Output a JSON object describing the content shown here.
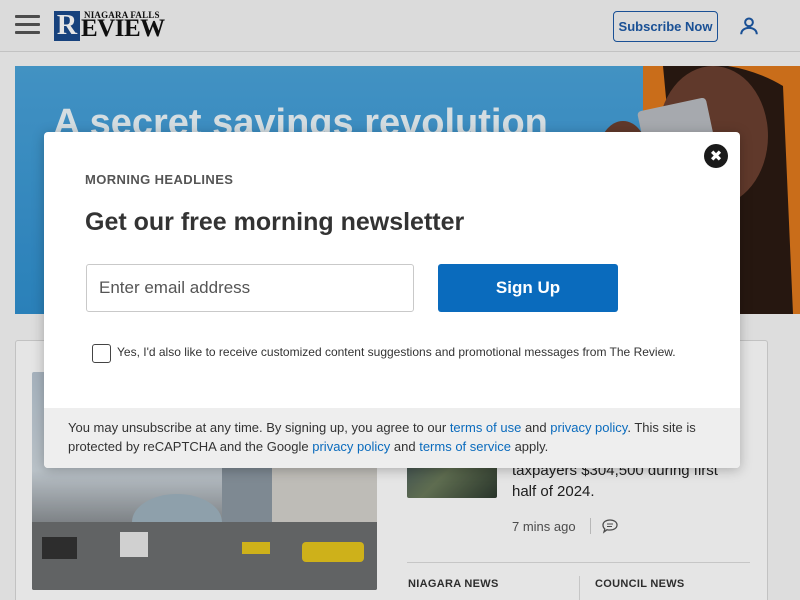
{
  "header": {
    "logo_top": "NIAGARA FALLS",
    "logo_initial": "R",
    "logo_rest": "EVIEW",
    "subscribe_label": "Subscribe Now"
  },
  "ad": {
    "headline": "A secret savings revolution"
  },
  "background_story": {
    "text_line1": "taxpayers $304,500 during first",
    "text_line2": "half of 2024.",
    "time": "7 mins ago",
    "sections": [
      "NIAGARA NEWS",
      "COUNCIL NEWS"
    ]
  },
  "modal": {
    "kicker": "MORNING HEADLINES",
    "headline": "Get our free morning newsletter",
    "email_placeholder": "Enter email address",
    "signup_label": "Sign Up",
    "consent_text": "Yes, I'd also like to receive customized content suggestions and promotional messages from The Review.",
    "footer": {
      "part1": "You may unsubscribe at any time. By signing up, you agree to our ",
      "terms_of_use": "terms of use",
      "part2": " and ",
      "privacy_policy_1": "privacy policy",
      "part3": ". This site is protected by reCAPTCHA and the Google ",
      "privacy_policy_2": "privacy policy",
      "part4": " and ",
      "terms_of_service": "terms of service",
      "part5": " apply."
    }
  },
  "colors": {
    "brand_blue": "#0a6bbd",
    "logo_blue": "#1a4a8c",
    "ad_blue": "#3a98d4"
  }
}
